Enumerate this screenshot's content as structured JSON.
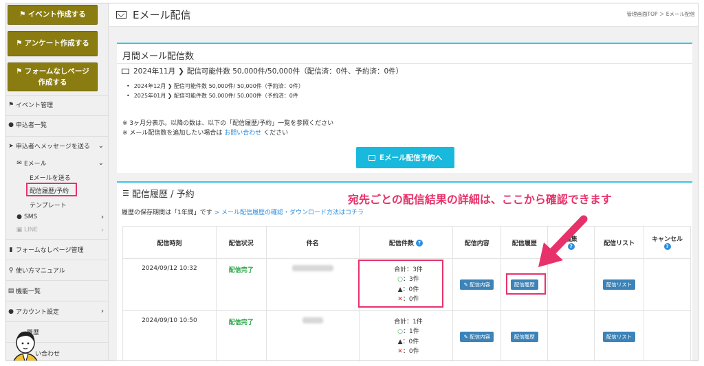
{
  "sidebar": {
    "btn_event": "イベント作成する",
    "btn_survey": "アンケート作成する",
    "btn_form_line1": "フォームなしページ",
    "btn_form_line2": "作成する",
    "items": {
      "event_mgmt": "イベント管理",
      "applicants": "申込者一覧",
      "send_msg": "申込者へメッセージを送る",
      "email": "Eメール",
      "email_send": "Eメールを送る",
      "email_history": "配信履歴/予約",
      "email_template": "テンプレート",
      "sms": "SMS",
      "line": "LINE",
      "formless": "フォームなしページ管理",
      "manual": "使い方マニュアル",
      "features": "機能一覧",
      "account": "アカウント設定",
      "history": "履歴",
      "contact": "い合わせ"
    }
  },
  "header": {
    "title": "Eメール配信",
    "breadcrumb": "管理画面TOP ＞ Eメール配信"
  },
  "monthly": {
    "heading": "月間メール配信数",
    "month": "2024年11月",
    "month_detail": "配信可能件数 50,000件/50,000件（配信済：0件、予約済：0件）",
    "bullets": [
      "2024年12月 ❯ 配信可能件数 50,000件/ 50,000件（予約済：0件）",
      "2025年01月 ❯ 配信可能件数 50,000件/ 50,000件（予約済：0件"
    ],
    "note1": "※ 3ヶ月分表示。以降の数は、以下の「配信履歴/予約」一覧を参照ください",
    "note2_prefix": "※ メール配信数を追加したい場合は ",
    "note2_link": "お問い合わせ",
    "note2_suffix": " ください",
    "reserve_button": "Eメール配信予約へ"
  },
  "history": {
    "heading": "配信履歴 / 予約",
    "annotation": "宛先ごとの配信結果の詳細は、ここから確認できます",
    "retention_prefix": "履歴の保存期間は「1年間」です",
    "retention_link": " > メール配信履歴の確認・ダウンロード方法はコチラ",
    "columns": [
      "配信時刻",
      "配信状況",
      "件名",
      "配信件数",
      "配信内容",
      "配信履歴",
      "編集",
      "配信リスト",
      "キャンセル"
    ],
    "rows": [
      {
        "time": "2024/09/12 10:32",
        "status": "配信完了",
        "total": "合計：3件",
        "ok": "：3件",
        "warn": "：0件",
        "ng": "：0件",
        "content_btn": "配信内容",
        "history_btn": "配信履歴",
        "list_btn": "配信リスト"
      },
      {
        "time": "2024/09/10 10:50",
        "status": "配信完了",
        "total": "合計：1件",
        "ok": "：1件",
        "warn": "：0件",
        "ng": "：0件",
        "content_btn": "配信内容",
        "history_btn": "配信履歴",
        "list_btn": "配信リスト"
      }
    ]
  },
  "colors": {
    "olive": "#8a7c10",
    "cyan": "#18b9dd",
    "pink": "#e8316a",
    "green": "#28a745",
    "blue": "#3b83b8"
  }
}
